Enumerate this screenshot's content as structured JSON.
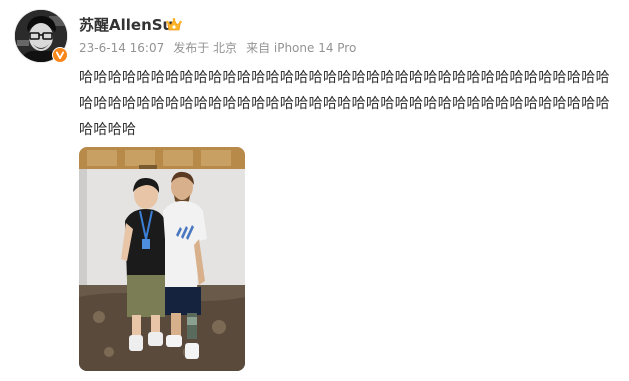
{
  "post": {
    "username": "苏醒AllenSu",
    "timestamp": "23-6-14 16:07",
    "location": "发布于 北京",
    "device": "来自 iPhone 14 Pro",
    "text": "哈哈哈哈哈哈哈哈哈哈哈哈哈哈哈哈哈哈哈哈哈哈哈哈哈哈哈哈哈哈哈哈哈哈哈哈哈哈哈哈哈哈哈哈哈哈哈哈哈哈哈哈哈哈哈哈哈哈哈哈哈哈哈哈哈哈哈哈哈哈哈哈哈哈哈哈哈哈",
    "verified": true,
    "membership_icon": "crown-icon",
    "verified_icon": "verified-v-icon"
  },
  "colors": {
    "name_text": "#333333",
    "meta_text": "#939393",
    "verified_orange": "#f7861b",
    "crown_yellow": "#fbb62b"
  }
}
